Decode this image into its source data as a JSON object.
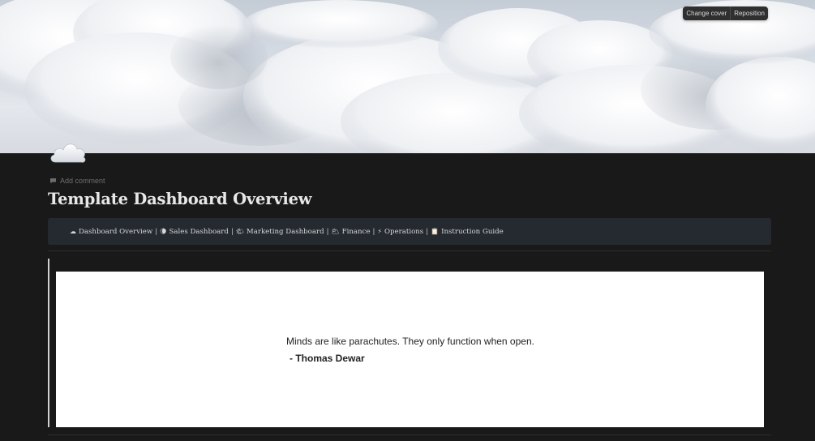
{
  "cover": {
    "change_cover_label": "Change cover",
    "reposition_label": "Reposition"
  },
  "page": {
    "icon": "cloud-icon",
    "add_comment_label": "Add comment",
    "title": "Template Dashboard Overview"
  },
  "nav": {
    "items": [
      {
        "emoji": "☁",
        "label": "Dashboard Overview",
        "icon": "cloud-icon"
      },
      {
        "emoji": "🌘",
        "label": "Sales Dashboard",
        "icon": "moon-icon"
      },
      {
        "emoji": "🌤",
        "label": "Marketing Dashboard",
        "icon": "sun-cloud-icon"
      },
      {
        "emoji": "🌥",
        "label": "Finance",
        "icon": "cloudy-icon"
      },
      {
        "emoji": "⚡",
        "label": "Operations",
        "icon": "lightning-icon"
      },
      {
        "emoji": "📋",
        "label": "Instruction Guide",
        "icon": "clipboard-icon"
      }
    ],
    "separator": "|"
  },
  "quote": {
    "text": "Minds are like parachutes. They only function when open.",
    "author": "- Thomas Dewar"
  },
  "colors": {
    "background": "#191919",
    "callout_bg": "#252a31",
    "embed_bg": "#ffffff"
  }
}
